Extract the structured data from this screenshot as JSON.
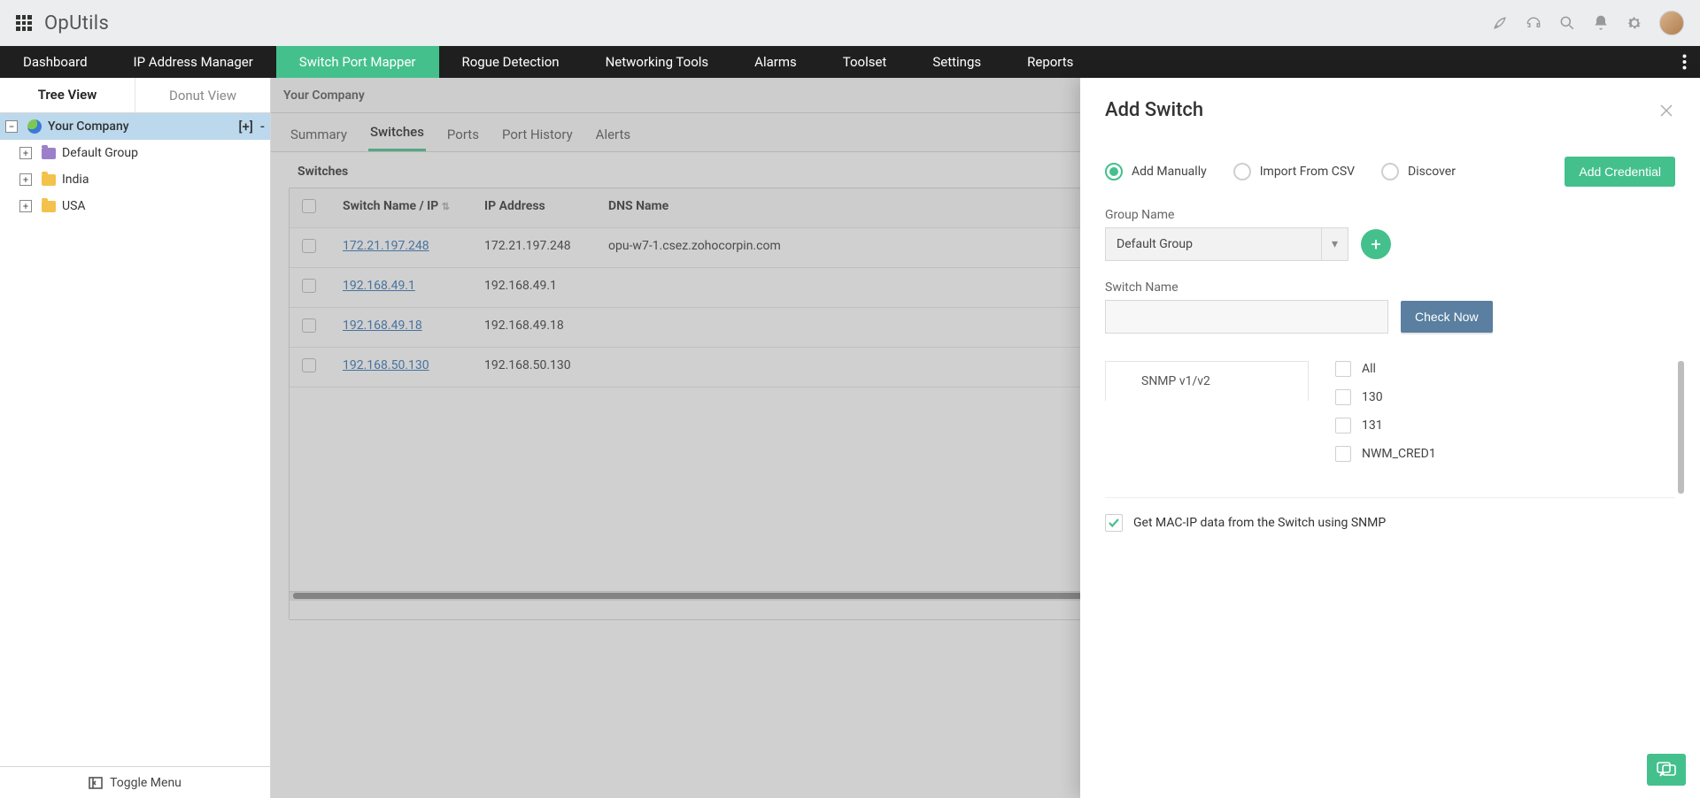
{
  "brand": "OpUtils",
  "topnav": [
    "Dashboard",
    "IP Address Manager",
    "Switch Port Mapper",
    "Rogue Detection",
    "Networking Tools",
    "Alarms",
    "Toolset",
    "Settings",
    "Reports"
  ],
  "topnav_active": 2,
  "viewtabs": {
    "tree": "Tree View",
    "donut": "Donut View"
  },
  "tree": {
    "root": "Your Company",
    "root_actions": {
      "add": "[+]",
      "collapse": "-"
    },
    "children": [
      {
        "label": "Default Group",
        "folder": "purple"
      },
      {
        "label": "India",
        "folder": "yellow"
      },
      {
        "label": "USA",
        "folder": "yellow"
      }
    ]
  },
  "toggle_menu": "Toggle Menu",
  "crumb": "Your Company",
  "subtabs": [
    "Summary",
    "Switches",
    "Ports",
    "Port History",
    "Alerts"
  ],
  "subtabs_active": 1,
  "section_title": "Switches",
  "grid": {
    "headers": {
      "name": "Switch Name / IP",
      "ip": "IP Address",
      "dns": "DNS Name"
    },
    "rows": [
      {
        "name": "172.21.197.248",
        "ip": "172.21.197.248",
        "dns": "opu-w7-1.csez.zohocorpin.com"
      },
      {
        "name": "192.168.49.1",
        "ip": "192.168.49.1",
        "dns": ""
      },
      {
        "name": "192.168.49.18",
        "ip": "192.168.49.18",
        "dns": ""
      },
      {
        "name": "192.168.50.130",
        "ip": "192.168.50.130",
        "dns": ""
      }
    ]
  },
  "panel": {
    "title": "Add Switch",
    "modes": {
      "manual": "Add Manually",
      "csv": "Import From CSV",
      "discover": "Discover"
    },
    "add_credential": "Add Credential",
    "group_label": "Group Name",
    "group_selected": "Default Group",
    "switch_label": "Switch Name",
    "switch_value": "",
    "check_now": "Check Now",
    "snmp_tab": "SNMP v1/v2",
    "credentials": [
      "All",
      "130",
      "131",
      "NWM_CRED1"
    ],
    "snmp_check": "Get MAC-IP data from the Switch using SNMP"
  }
}
